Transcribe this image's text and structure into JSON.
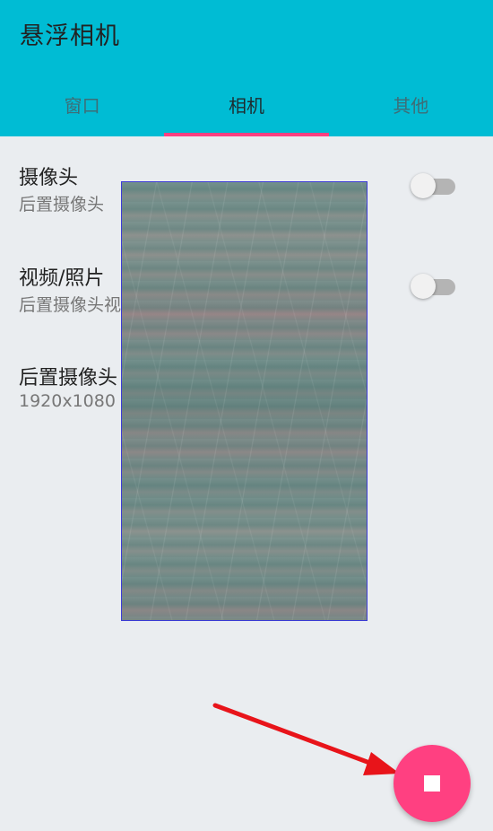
{
  "app": {
    "title": "悬浮相机"
  },
  "tabs": [
    {
      "label": "窗口",
      "active": false
    },
    {
      "label": "相机",
      "active": true
    },
    {
      "label": "其他",
      "active": false
    }
  ],
  "settings": [
    {
      "title": "摄像头",
      "subtitle": "后置摄像头",
      "toggle": false
    },
    {
      "title": "视频/照片",
      "subtitle": "后置摄像头视",
      "toggle": false
    },
    {
      "title": "后置摄像头",
      "subtitle": "1920x1080"
    }
  ],
  "fab": {
    "icon": "stop-icon"
  },
  "colors": {
    "app_bar": "#00bcd4",
    "accent": "#ff4081",
    "background": "#eaedf0",
    "annotation_arrow": "#e8141a"
  }
}
